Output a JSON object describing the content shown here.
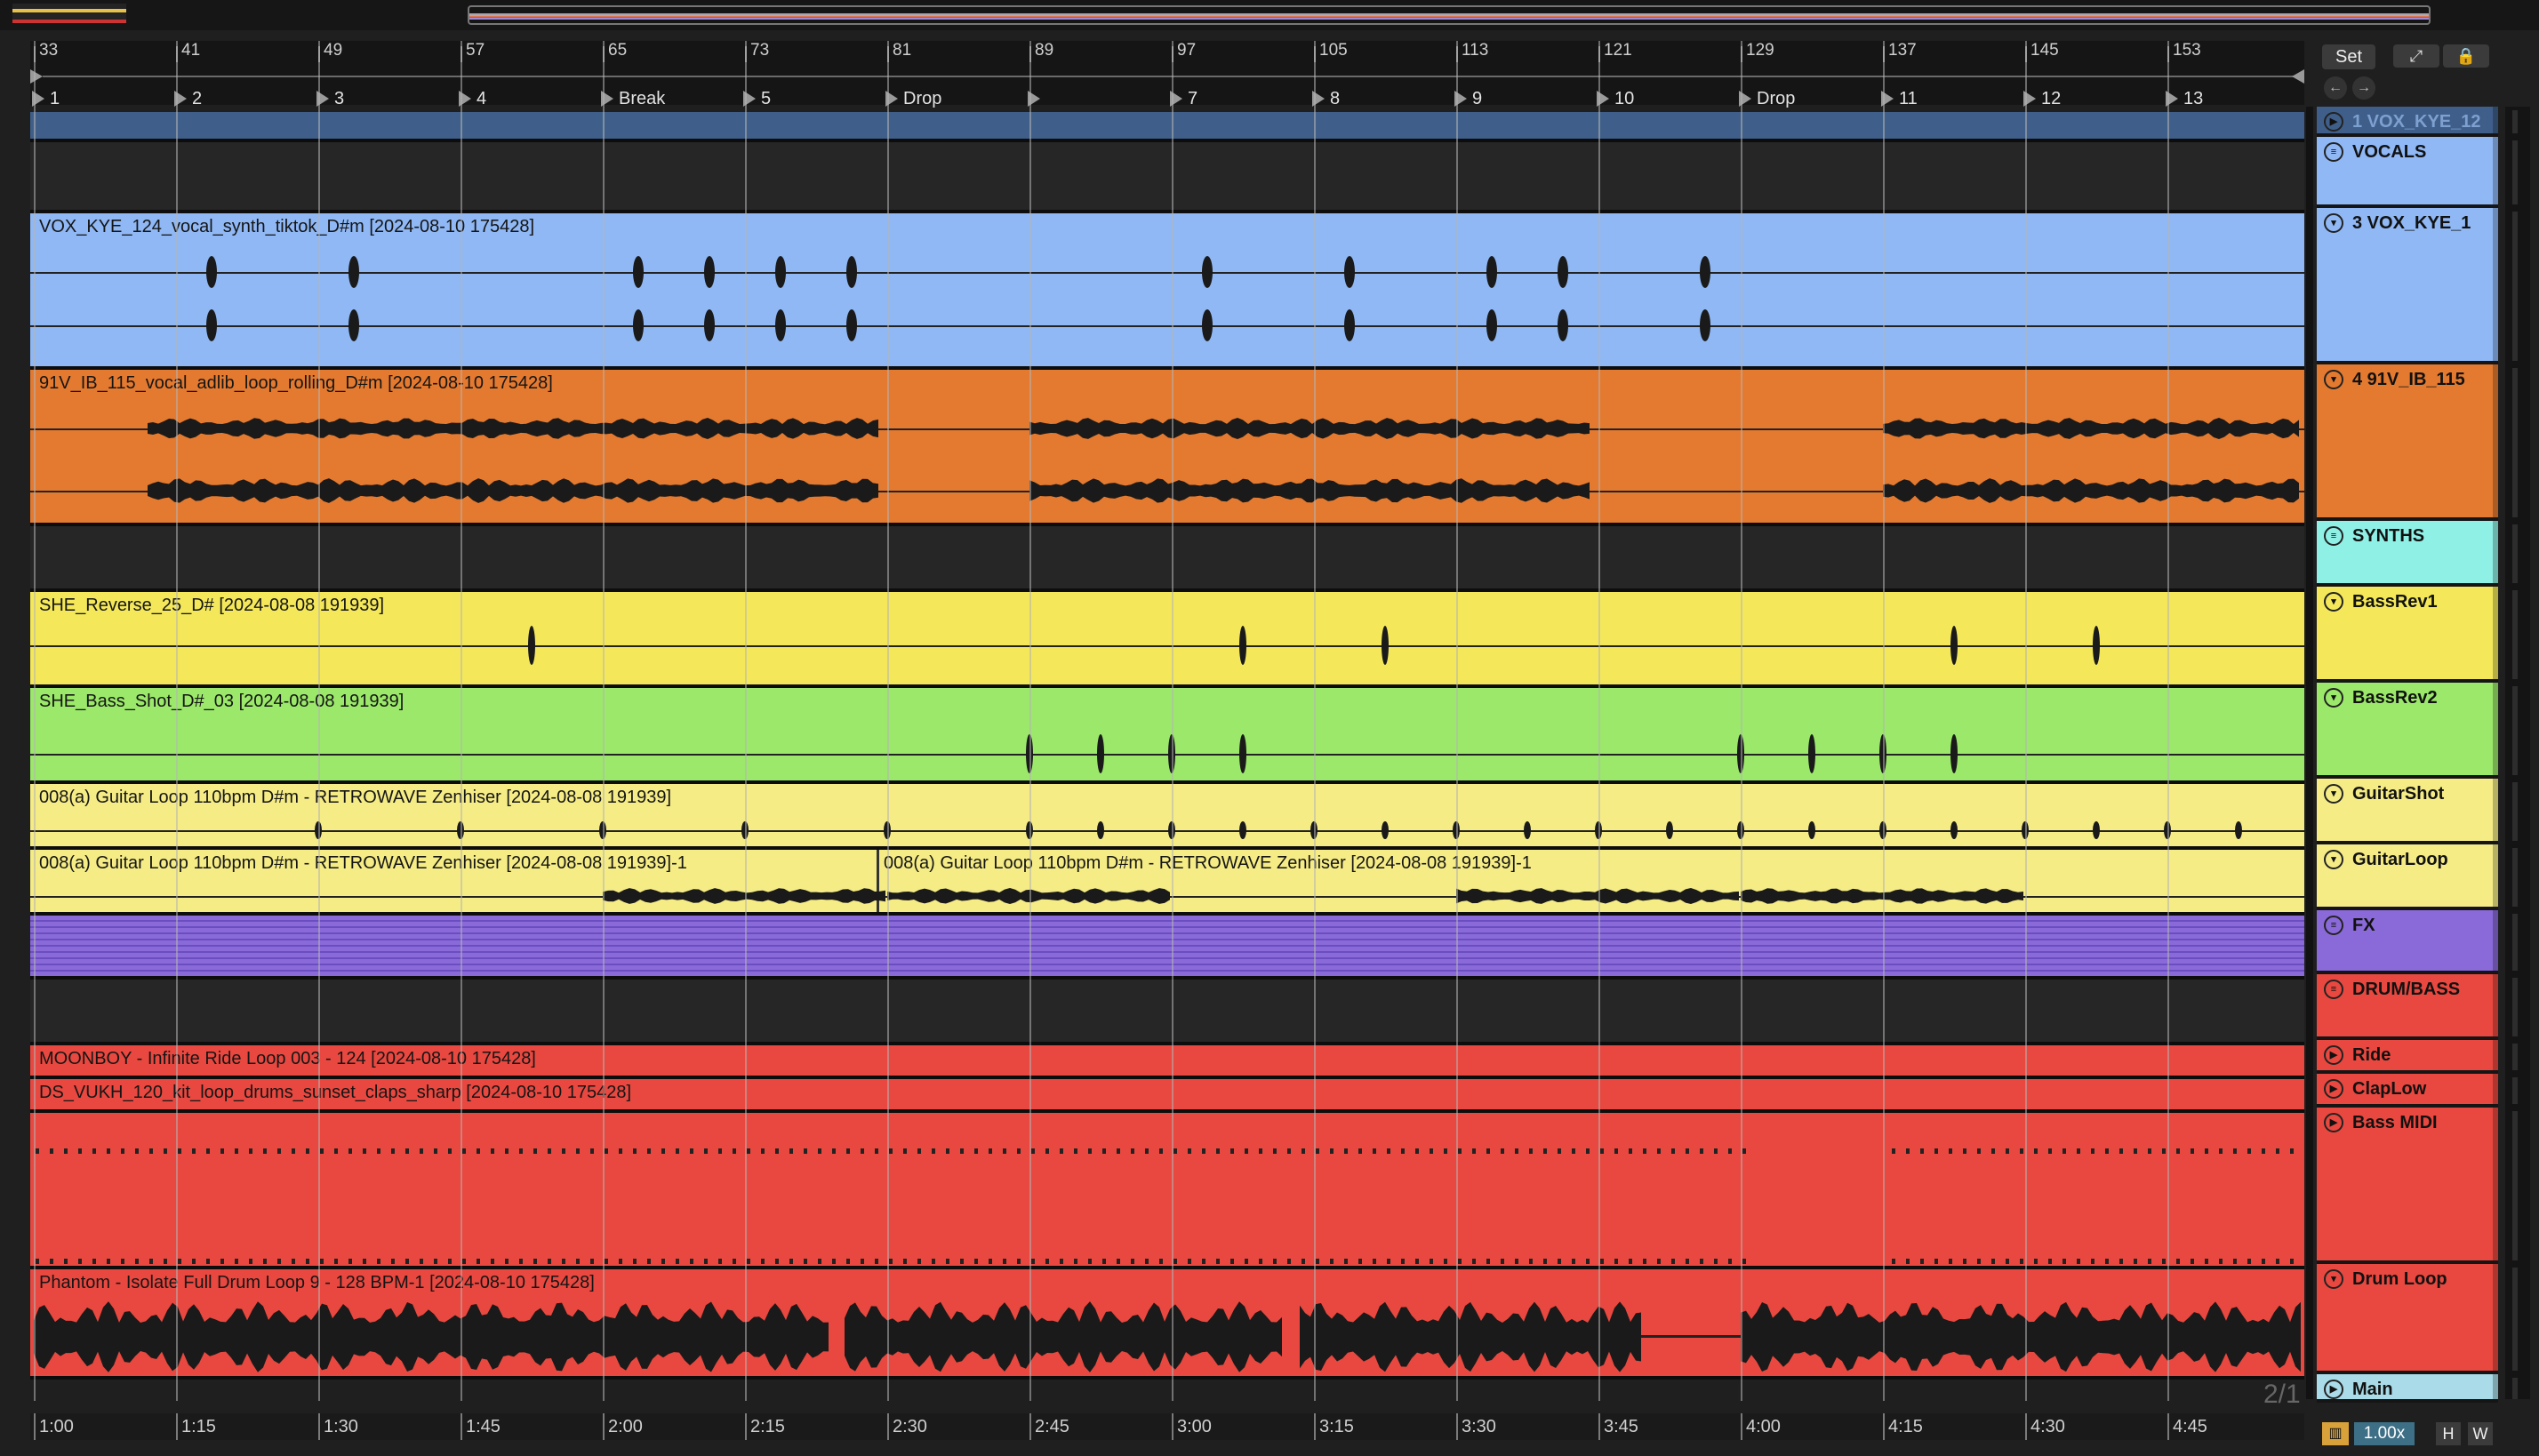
{
  "ruler": {
    "bars": [
      "33",
      "41",
      "49",
      "57",
      "65",
      "73",
      "81",
      "89",
      "97",
      "105",
      "113",
      "121",
      "129",
      "137",
      "145",
      "153"
    ]
  },
  "locators": [
    "1",
    "2",
    "3",
    "4",
    "Break",
    "5",
    "Drop",
    "",
    "7",
    "8",
    "9",
    "10",
    "Drop",
    "11",
    "12",
    "13"
  ],
  "times": [
    "1:00",
    "1:15",
    "1:30",
    "1:45",
    "2:00",
    "2:15",
    "2:30",
    "2:45",
    "3:00",
    "3:15",
    "3:30",
    "3:45",
    "4:00",
    "4:15",
    "4:30",
    "4:45"
  ],
  "toolbar": {
    "set_label": "Set",
    "expand_icon": "expand-icon",
    "lock_icon": "lock-icon"
  },
  "clips": {
    "vox": "VOX_KYE_124_vocal_synth_tiktok_D#m [2024-08-10 175428]",
    "adlib": "91V_IB_115_vocal_adlib_loop_rolling_D#m [2024-08-10 175428]",
    "reverse": "SHE_Reverse_25_D# [2024-08-08 191939]",
    "bassshot": "SHE_Bass_Shot_D#_03 [2024-08-08 191939]",
    "guitar1": "008(a) Guitar Loop 110bpm D#m - RETROWAVE Zenhiser [2024-08-08 191939]",
    "guitar2a": "008(a) Guitar Loop 110bpm D#m - RETROWAVE Zenhiser [2024-08-08 191939]-1",
    "guitar2b": "008(a) Guitar Loop 110bpm D#m - RETROWAVE Zenhiser [2024-08-08 191939]-1",
    "ride": "MOONBOY - Infinite Ride Loop 003 - 124 [2024-08-10 175428]",
    "claps": "DS_VUKH_120_kit_loop_drums_sunset_claps_sharp [2024-08-10 175428]",
    "drum": "Phantom - Isolate Full Drum Loop 9 - 128 BPM-1 [2024-08-10 175428]"
  },
  "tracks": [
    {
      "label": "1 VOX_KYE_12",
      "color": "#3f5f8a"
    },
    {
      "label": "VOCALS",
      "color": "#8fb8f5"
    },
    {
      "label": "3 VOX_KYE_1",
      "color": "#8fb8f5"
    },
    {
      "label": "4 91V_IB_115",
      "color": "#e47a30"
    },
    {
      "label": "SYNTHS",
      "color": "#8ff0e6"
    },
    {
      "label": "BassRev1",
      "color": "#f4e85a"
    },
    {
      "label": "BassRev2",
      "color": "#9be86a"
    },
    {
      "label": "GuitarShot",
      "color": "#f5ec86"
    },
    {
      "label": "GuitarLoop",
      "color": "#f5ec86"
    },
    {
      "label": "FX",
      "color": "#8a6ad8"
    },
    {
      "label": "DRUM/BASS",
      "color": "#e8483f"
    },
    {
      "label": "Ride",
      "color": "#e8483f"
    },
    {
      "label": "ClapLow",
      "color": "#e8483f"
    },
    {
      "label": "Bass MIDI",
      "color": "#e8483f"
    },
    {
      "label": "Drum Loop",
      "color": "#e8483f"
    },
    {
      "label": "Main",
      "color": "#a9dbe8"
    }
  ],
  "footer": {
    "zoom": "1.00x",
    "h": "H",
    "w": "W",
    "page": "2/1"
  },
  "colors": {
    "vocal": "#8fb8f5",
    "adlib": "#e47a30",
    "synth_yellow": "#f4e85a",
    "green": "#9be86a",
    "guitar": "#f5ec86",
    "fx": "#8a6ad8",
    "drum": "#e8483f"
  }
}
